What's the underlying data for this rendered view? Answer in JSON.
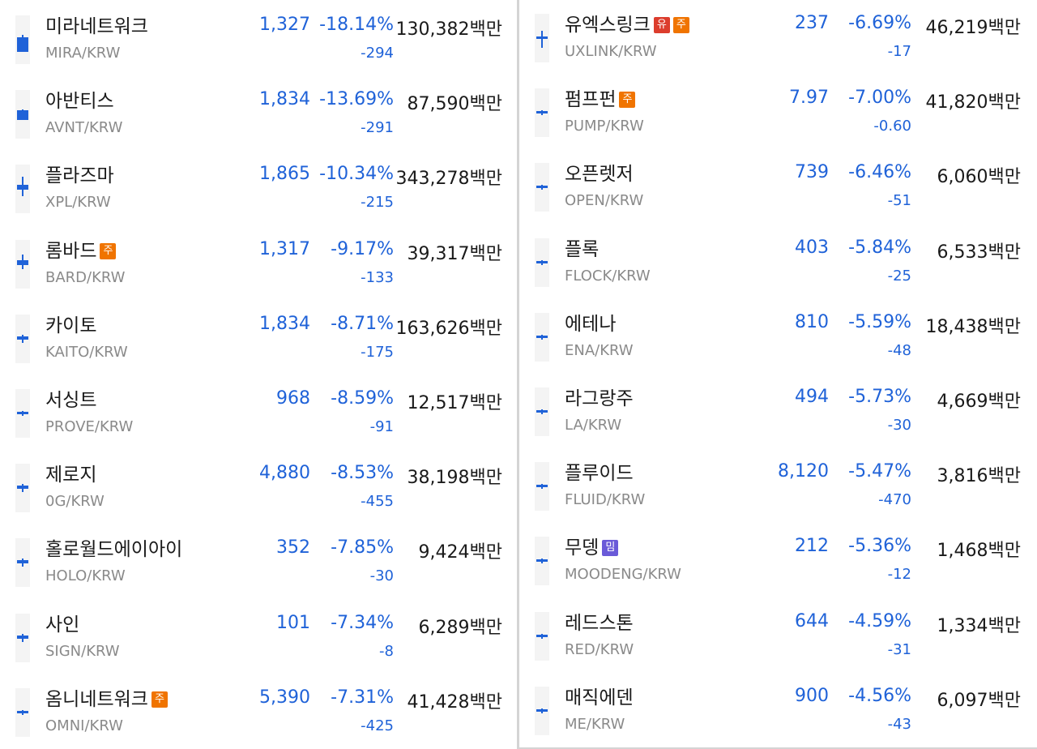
{
  "colors": {
    "down": "#1f62d8",
    "text": "#1a1a1a",
    "muted": "#8a8a8a",
    "badge_caution": "#f07400",
    "badge_warning": "#dc3d2d",
    "badge_meme": "#6a5ad8"
  },
  "left_list": [
    {
      "name": "미라네트워크",
      "pair": "MIRA/KRW",
      "price": "1,327",
      "change": "-18.14%",
      "diff": "-294",
      "volume": "130,382백만",
      "badges": [],
      "candle": {
        "wick": [
          0.4,
          0.6
        ],
        "body": [
          0.45,
          0.75
        ]
      }
    },
    {
      "name": "아반티스",
      "pair": "AVNT/KRW",
      "price": "1,834",
      "change": "-13.69%",
      "diff": "-291",
      "volume": "87,590백만",
      "badges": [],
      "candle": {
        "wick": [
          0.4,
          0.6
        ],
        "body": [
          0.42,
          0.62
        ]
      }
    },
    {
      "name": "플라즈마",
      "pair": "XPL/KRW",
      "price": "1,865",
      "change": "-10.34%",
      "diff": "-215",
      "volume": "343,278백만",
      "badges": [],
      "candle": {
        "wick": [
          0.25,
          0.65
        ],
        "body": [
          0.42,
          0.52
        ]
      }
    },
    {
      "name": "롬바드",
      "pair": "BARD/KRW",
      "price": "1,317",
      "change": "-9.17%",
      "diff": "-133",
      "volume": "39,317백만",
      "badges": [
        {
          "text": "주",
          "type": "caution"
        }
      ],
      "candle": {
        "wick": [
          0.3,
          0.6
        ],
        "body": [
          0.42,
          0.52
        ]
      }
    },
    {
      "name": "카이토",
      "pair": "KAITO/KRW",
      "price": "1,834",
      "change": "-8.71%",
      "diff": "-175",
      "volume": "163,626백만",
      "badges": [],
      "candle": {
        "wick": [
          0.42,
          0.58
        ],
        "body": [
          0.45,
          0.52
        ]
      }
    },
    {
      "name": "서싱트",
      "pair": "PROVE/KRW",
      "price": "968",
      "change": "-8.59%",
      "diff": "-91",
      "volume": "12,517백만",
      "badges": [],
      "candle": {
        "wick": [
          0.45,
          0.55
        ],
        "body": [
          0.46,
          0.52
        ]
      }
    },
    {
      "name": "제로지",
      "pair": "0G/KRW",
      "price": "4,880",
      "change": "-8.53%",
      "diff": "-455",
      "volume": "38,198백만",
      "badges": [],
      "candle": {
        "wick": [
          0.42,
          0.58
        ],
        "body": [
          0.45,
          0.52
        ]
      }
    },
    {
      "name": "홀로월드에이아이",
      "pair": "HOLO/KRW",
      "price": "352",
      "change": "-7.85%",
      "diff": "-30",
      "volume": "9,424백만",
      "badges": [],
      "candle": {
        "wick": [
          0.42,
          0.58
        ],
        "body": [
          0.45,
          0.52
        ]
      }
    },
    {
      "name": "사인",
      "pair": "SIGN/KRW",
      "price": "101",
      "change": "-7.34%",
      "diff": "-8",
      "volume": "6,289백만",
      "badges": [],
      "candle": {
        "wick": [
          0.42,
          0.58
        ],
        "body": [
          0.45,
          0.52
        ]
      }
    },
    {
      "name": "옴니네트워크",
      "pair": "OMNI/KRW",
      "price": "5,390",
      "change": "-7.31%",
      "diff": "-425",
      "volume": "41,428백만",
      "badges": [
        {
          "text": "주",
          "type": "caution"
        }
      ],
      "candle": {
        "wick": [
          0.45,
          0.55
        ],
        "body": [
          0.46,
          0.52
        ]
      }
    }
  ],
  "right_list": [
    {
      "name": "유엑스링크",
      "pair": "UXLINK/KRW",
      "price": "237",
      "change": "-6.69%",
      "diff": "-17",
      "volume": "46,219백만",
      "badges": [
        {
          "text": "유",
          "type": "warning"
        },
        {
          "text": "주",
          "type": "caution"
        }
      ],
      "candle": {
        "wick": [
          0.35,
          0.7
        ],
        "body": [
          0.46,
          0.52
        ]
      }
    },
    {
      "name": "펌프펀",
      "pair": "PUMP/KRW",
      "price": "7.97",
      "change": "-7.00%",
      "diff": "-0.60",
      "volume": "41,820백만",
      "badges": [
        {
          "text": "주",
          "type": "caution"
        }
      ],
      "candle": {
        "wick": [
          0.45,
          0.55
        ],
        "body": [
          0.46,
          0.52
        ]
      }
    },
    {
      "name": "오픈렛저",
      "pair": "OPEN/KRW",
      "price": "739",
      "change": "-6.46%",
      "diff": "-51",
      "volume": "6,060백만",
      "badges": [],
      "candle": {
        "wick": [
          0.45,
          0.55
        ],
        "body": [
          0.46,
          0.52
        ]
      }
    },
    {
      "name": "플록",
      "pair": "FLOCK/KRW",
      "price": "403",
      "change": "-5.84%",
      "diff": "-25",
      "volume": "6,533백만",
      "badges": [],
      "candle": {
        "wick": [
          0.45,
          0.55
        ],
        "body": [
          0.46,
          0.52
        ]
      }
    },
    {
      "name": "에테나",
      "pair": "ENA/KRW",
      "price": "810",
      "change": "-5.59%",
      "diff": "-48",
      "volume": "18,438백만",
      "badges": [],
      "candle": {
        "wick": [
          0.45,
          0.55
        ],
        "body": [
          0.46,
          0.52
        ]
      }
    },
    {
      "name": "라그랑주",
      "pair": "LA/KRW",
      "price": "494",
      "change": "-5.73%",
      "diff": "-30",
      "volume": "4,669백만",
      "badges": [],
      "candle": {
        "wick": [
          0.45,
          0.55
        ],
        "body": [
          0.46,
          0.52
        ]
      }
    },
    {
      "name": "플루이드",
      "pair": "FLUID/KRW",
      "price": "8,120",
      "change": "-5.47%",
      "diff": "-470",
      "volume": "3,816백만",
      "badges": [],
      "candle": {
        "wick": [
          0.45,
          0.55
        ],
        "body": [
          0.46,
          0.52
        ]
      }
    },
    {
      "name": "무뎅",
      "pair": "MOODENG/KRW",
      "price": "212",
      "change": "-5.36%",
      "diff": "-12",
      "volume": "1,468백만",
      "badges": [
        {
          "text": "밈",
          "type": "meme"
        }
      ],
      "candle": {
        "wick": [
          0.45,
          0.55
        ],
        "body": [
          0.46,
          0.52
        ]
      }
    },
    {
      "name": "레드스톤",
      "pair": "RED/KRW",
      "price": "644",
      "change": "-4.59%",
      "diff": "-31",
      "volume": "1,334백만",
      "badges": [],
      "candle": {
        "wick": [
          0.45,
          0.55
        ],
        "body": [
          0.46,
          0.52
        ]
      }
    },
    {
      "name": "매직에덴",
      "pair": "ME/KRW",
      "price": "900",
      "change": "-4.56%",
      "diff": "-43",
      "volume": "6,097백만",
      "badges": [],
      "candle": {
        "wick": [
          0.45,
          0.55
        ],
        "body": [
          0.46,
          0.52
        ]
      }
    }
  ]
}
